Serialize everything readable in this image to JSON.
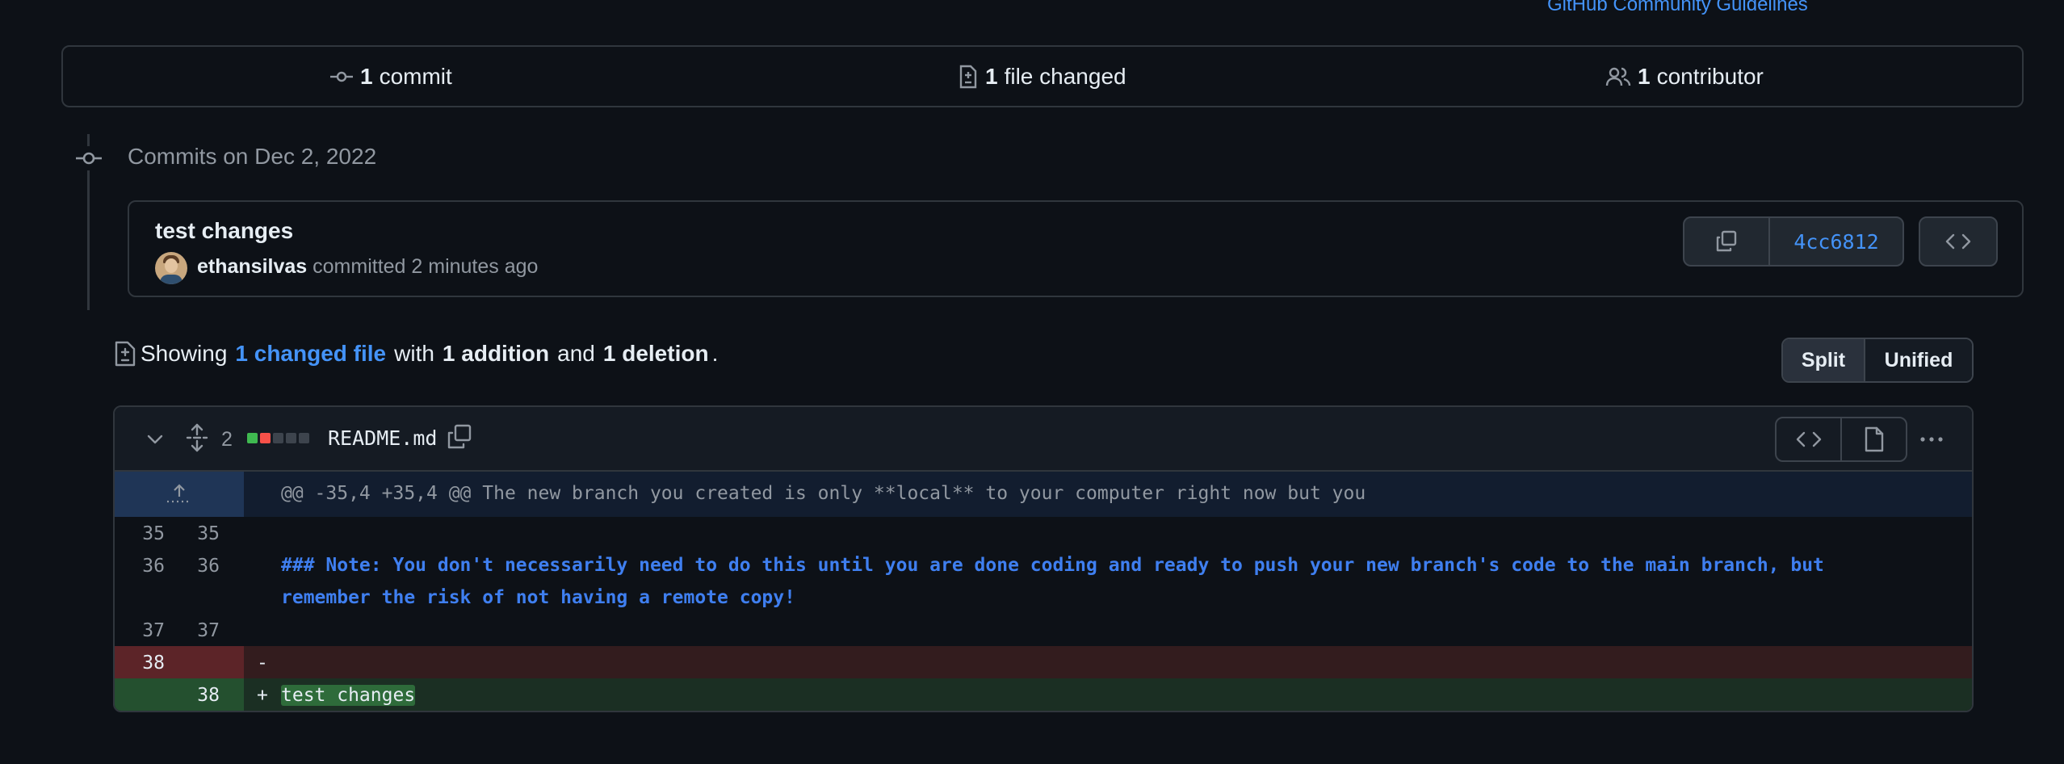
{
  "top_link": "GitHub Community Guidelines",
  "summary": {
    "commits": {
      "count": "1",
      "label": "commit"
    },
    "files": {
      "count": "1",
      "label": "file changed"
    },
    "contributors": {
      "count": "1",
      "label": "contributor"
    }
  },
  "timeline": {
    "heading": "Commits on Dec 2, 2022"
  },
  "commit": {
    "title": "test changes",
    "author": "ethansilvas",
    "meta": "committed 2 minutes ago",
    "sha": "4cc6812"
  },
  "showing": {
    "prefix": "Showing",
    "changed_files": "1 changed file",
    "with": "with",
    "additions": "1 addition",
    "and": "and",
    "deletions": "1 deletion",
    "period": "."
  },
  "view_toggle": {
    "split": "Split",
    "unified": "Unified",
    "selected": "Split"
  },
  "diff": {
    "change_count": "2",
    "filename": "README.md",
    "diffstat": [
      "added",
      "deleted",
      "neutral",
      "neutral",
      "neutral"
    ],
    "hunk_header": "@@ -35,4 +35,4 @@ The new branch you created is only **local** to your computer right now but you",
    "lines": [
      {
        "old": "35",
        "new": "35",
        "type": "context",
        "text": ""
      },
      {
        "old": "36",
        "new": "36",
        "type": "context",
        "text": "### Note: You don't necessarily need to do this until you are done coding and ready to push your new branch's code to the main branch, but remember the risk of not having a remote copy!"
      },
      {
        "old": "37",
        "new": "37",
        "type": "context",
        "text": ""
      },
      {
        "old": "38",
        "new": "",
        "type": "deletion",
        "sign": "-",
        "text": ""
      },
      {
        "old": "",
        "new": "38",
        "type": "addition",
        "sign": "+",
        "text": "test changes"
      }
    ]
  },
  "colors": {
    "background": "#0d1117",
    "accent": "#4493f8",
    "addition": "#3fb950",
    "deletion": "#f85149"
  }
}
